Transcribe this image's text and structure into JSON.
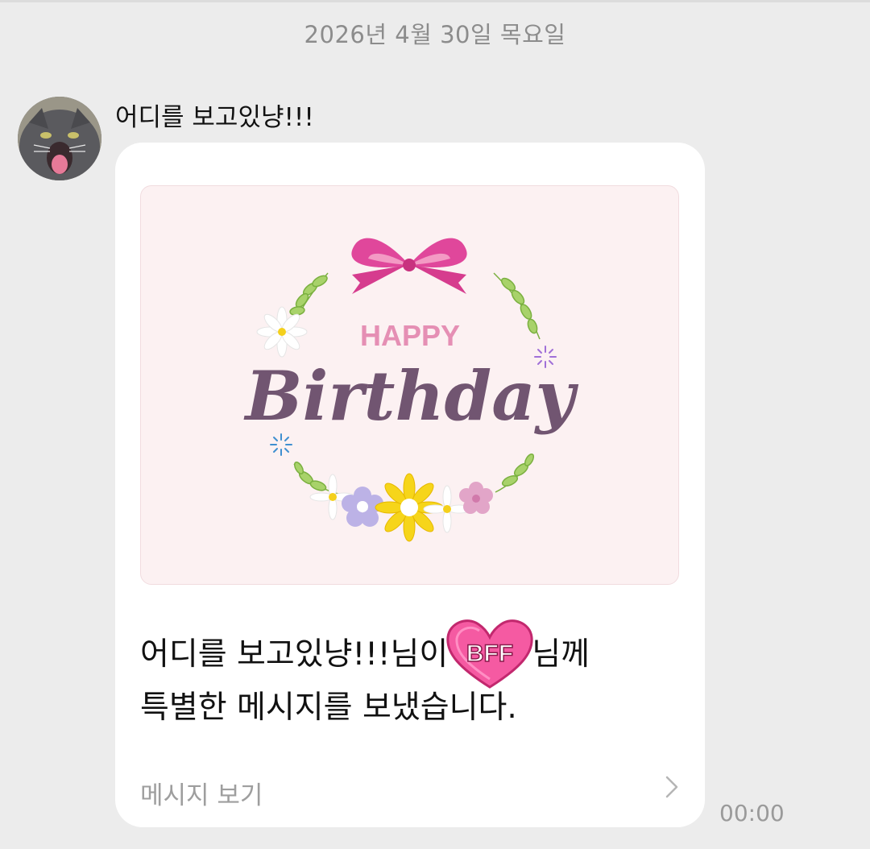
{
  "chat": {
    "date_separator": "2026년 4월 30일 목요일",
    "sender_name": "어디를 보고있냥!!!",
    "message": {
      "card": {
        "happy_text": "HAPPY",
        "birthday_text": "Birthday",
        "colors": {
          "background": "#fcf1f2",
          "happy": "#e58fb4",
          "birthday": "#715571",
          "ribbon": "#e0479b"
        }
      },
      "text_part1": "어디를 보고있냥!!!님이",
      "sticker_text": "BFF",
      "text_part2": "님께",
      "text_line2": "특별한 메시지를 보냈습니다.",
      "view_label": "메시지 보기",
      "chevron_icon": "chevron-right-icon",
      "time": "00:00"
    }
  }
}
